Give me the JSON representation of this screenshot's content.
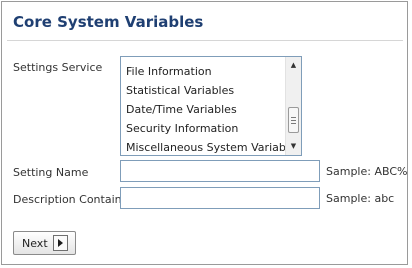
{
  "page": {
    "title": "Core System Variables"
  },
  "settings_service": {
    "label": "Settings Service",
    "options": [
      "File Information",
      "Statistical Variables",
      "Date/Time Variables",
      "Security Information",
      "Miscellaneous System Variables"
    ]
  },
  "setting_name": {
    "label": "Setting Name",
    "value": "",
    "sample": "Sample: ABC%"
  },
  "description_contains": {
    "label": "Description Contains",
    "value": "",
    "sample": "Sample: abc"
  },
  "actions": {
    "next_label": "Next",
    "next_icon": "arrow-right-icon"
  },
  "colors": {
    "title": "#1f3f72",
    "field_border": "#7f9db9"
  }
}
